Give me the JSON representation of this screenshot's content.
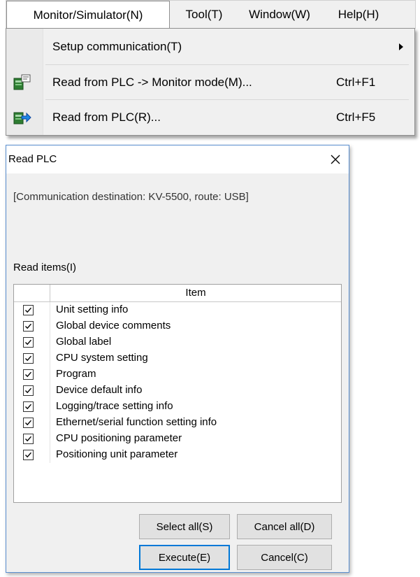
{
  "menubar": {
    "items": [
      {
        "label": "Monitor/Simulator(N)"
      },
      {
        "label": "Tool(T)"
      },
      {
        "label": "Window(W)"
      },
      {
        "label": "Help(H)"
      }
    ]
  },
  "dropdown": {
    "items": [
      {
        "label": "Setup communication(T)",
        "shortcut": "",
        "icon": "",
        "has_submenu": true
      },
      {
        "label": "Read from PLC -> Monitor mode(M)...",
        "shortcut": "Ctrl+F1",
        "icon": "monitor-read-icon"
      },
      {
        "label": "Read from PLC(R)...",
        "shortcut": "Ctrl+F5",
        "icon": "plc-read-icon"
      }
    ]
  },
  "dialog": {
    "title": "Read PLC",
    "destination": "[Communication destination: KV-5500, route: USB]",
    "read_items_label": "Read items(I)",
    "table": {
      "header": "Item",
      "rows": [
        {
          "label": "Unit setting info",
          "checked": true
        },
        {
          "label": "Global device comments",
          "checked": true
        },
        {
          "label": "Global label",
          "checked": true
        },
        {
          "label": "CPU system setting",
          "checked": true
        },
        {
          "label": "Program",
          "checked": true
        },
        {
          "label": "Device default info",
          "checked": true
        },
        {
          "label": "Logging/trace setting info",
          "checked": true
        },
        {
          "label": "Ethernet/serial function setting info",
          "checked": true
        },
        {
          "label": "CPU positioning parameter",
          "checked": true
        },
        {
          "label": "Positioning unit parameter",
          "checked": true
        }
      ]
    },
    "buttons": {
      "select_all": "Select all(S)",
      "cancel_all": "Cancel all(D)",
      "execute": "Execute(E)",
      "cancel": "Cancel(C)"
    }
  }
}
